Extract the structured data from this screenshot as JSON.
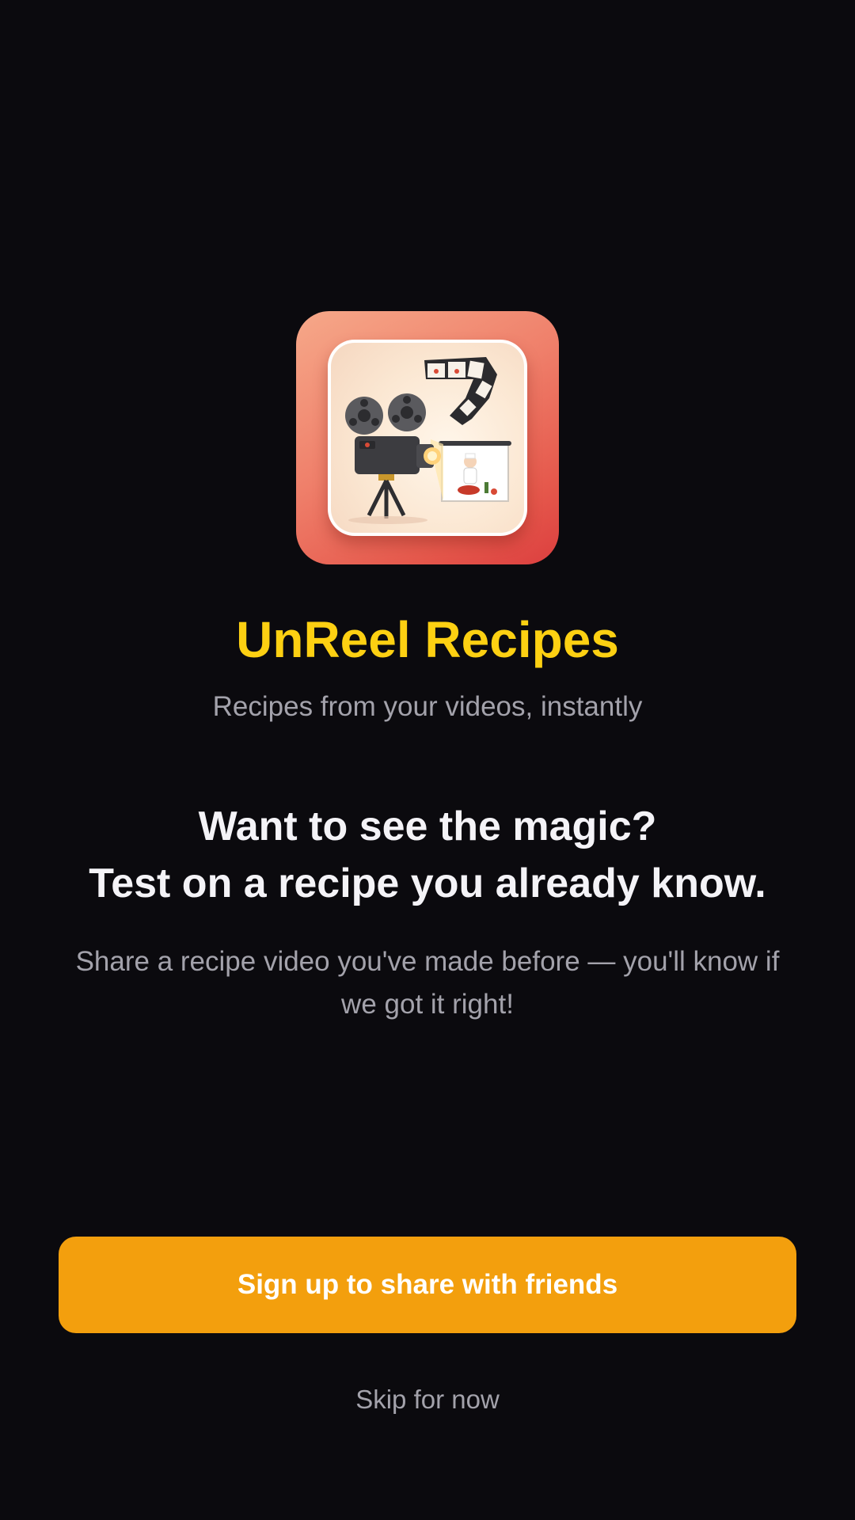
{
  "app": {
    "name": "UnReel Recipes",
    "tagline": "Recipes from your videos, instantly",
    "icon": "film-camera-chef-app-icon",
    "title_color": "#fdd012"
  },
  "onboarding": {
    "headline_line1": "Want to see the magic?",
    "headline_line2": "Test on a recipe you already know.",
    "description": "Share a recipe video you've made before — you'll know if we got it right!"
  },
  "actions": {
    "primary_label": "Sign up to share with friends",
    "primary_color": "#f39f0d",
    "skip_label": "Skip for now"
  },
  "colors": {
    "background": "#0b0a0e",
    "muted_text": "#a3a2ab",
    "headline_text": "#f4f3f7"
  }
}
